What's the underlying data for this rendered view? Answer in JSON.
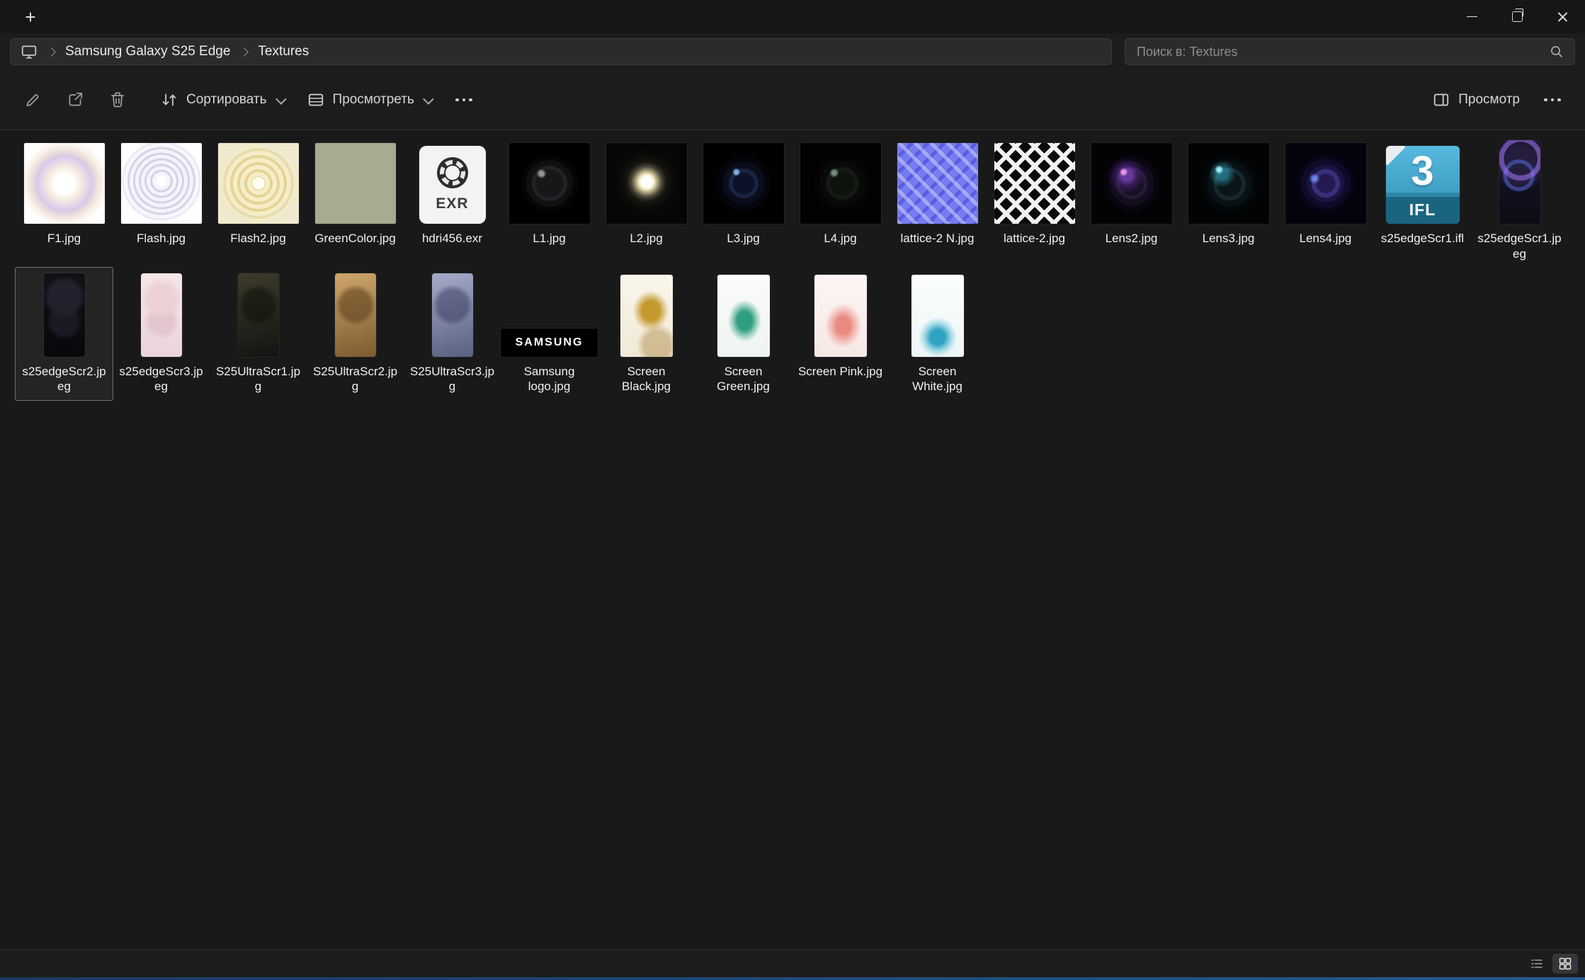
{
  "tab_bar": {
    "new_tab_glyph": "+"
  },
  "window_controls": {
    "buttons": [
      "minimize",
      "restore",
      "close"
    ]
  },
  "address_bar": {
    "breadcrumbs": [
      "Samsung Galaxy S25 Edge",
      "Textures"
    ],
    "search_placeholder": "Поиск в: Textures"
  },
  "toolbar": {
    "sort_label": "Сортировать",
    "view_label": "Просмотреть",
    "preview_label": "Просмотр"
  },
  "files": [
    {
      "name": "F1.jpg",
      "kind": "square",
      "thumb": "t-f1"
    },
    {
      "name": "Flash.jpg",
      "kind": "square",
      "thumb": "t-flash"
    },
    {
      "name": "Flash2.jpg",
      "kind": "square",
      "thumb": "t-flash2"
    },
    {
      "name": "GreenColor.jpg",
      "kind": "square",
      "thumb": "t-green"
    },
    {
      "name": "hdri456.exr",
      "kind": "doc",
      "thumb": "t-exr",
      "badge": "EXR",
      "aperture": true
    },
    {
      "name": "L1.jpg",
      "kind": "square",
      "thumb": "t-l1"
    },
    {
      "name": "L2.jpg",
      "kind": "square",
      "thumb": "t-l2"
    },
    {
      "name": "L3.jpg",
      "kind": "square",
      "thumb": "t-l3"
    },
    {
      "name": "L4.jpg",
      "kind": "square",
      "thumb": "t-l4"
    },
    {
      "name": "lattice-2 N.jpg",
      "kind": "square",
      "thumb": "t-latticen"
    },
    {
      "name": "lattice-2.jpg",
      "kind": "square",
      "thumb": "t-lattice"
    },
    {
      "name": "Lens2.jpg",
      "kind": "square",
      "thumb": "t-lens2"
    },
    {
      "name": "Lens3.jpg",
      "kind": "square",
      "thumb": "t-lens3"
    },
    {
      "name": "Lens4.jpg",
      "kind": "square",
      "thumb": "t-lens4"
    },
    {
      "name": "s25edgeScr1.ifl",
      "kind": "ifl",
      "thumb": "t-ifl",
      "big": "3",
      "badge": "IFL"
    },
    {
      "name": "s25edgeScr1.jpeg",
      "kind": "phone",
      "thumb": "t-s25a"
    },
    {
      "name": "s25edgeScr2.jpeg",
      "kind": "phone",
      "thumb": "t-s25b",
      "selected": true
    },
    {
      "name": "s25edgeScr3.jpeg",
      "kind": "phone",
      "thumb": "t-s25c"
    },
    {
      "name": "S25UltraScr1.jpg",
      "kind": "phone",
      "thumb": "t-u1"
    },
    {
      "name": "S25UltraScr2.jpg",
      "kind": "phone",
      "thumb": "t-u2"
    },
    {
      "name": "S25UltraScr3.jpg",
      "kind": "phone",
      "thumb": "t-u3"
    },
    {
      "name": "Samsung logo.jpg",
      "kind": "wide",
      "thumb": "t-samsung",
      "text": "SAMSUNG"
    },
    {
      "name": "Screen Black.jpg",
      "kind": "screen",
      "thumb": "t-sb"
    },
    {
      "name": "Screen Green.jpg",
      "kind": "screen",
      "thumb": "t-sg"
    },
    {
      "name": "Screen Pink.jpg",
      "kind": "screen",
      "thumb": "t-sp"
    },
    {
      "name": "Screen White.jpg",
      "kind": "screen",
      "thumb": "t-sw"
    }
  ],
  "status_bar": {
    "view_toggles": [
      "details-view",
      "thumbnail-view"
    ],
    "active_view": "thumbnail-view"
  },
  "colors": {
    "window_bg": "#191919",
    "header_bg": "#1c1c1c",
    "pill_bg": "#2b2b2b",
    "selection_outline": "#6f6f6f",
    "ifl_icon_blue": "#3f9fc4",
    "bottom_edge_blue": "#27598f"
  }
}
